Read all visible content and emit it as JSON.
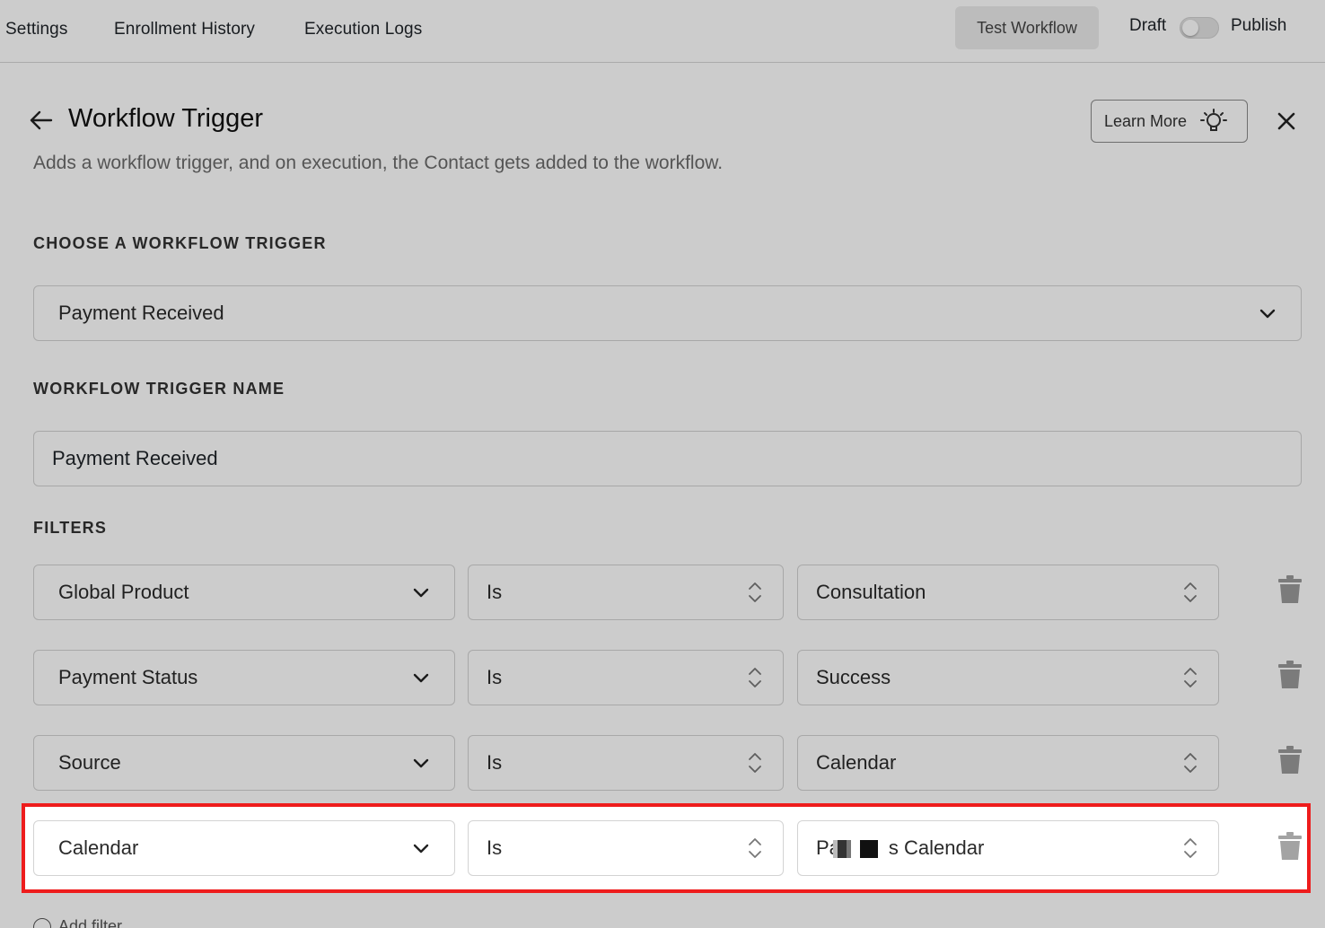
{
  "topbar": {
    "nav": [
      "Settings",
      "Enrollment History",
      "Execution Logs"
    ],
    "test_button": "Test Workflow",
    "draft_label": "Draft",
    "publish_label": "Publish"
  },
  "header": {
    "title": "Workflow Trigger",
    "subtitle": "Adds a workflow trigger, and on execution, the Contact gets added to the workflow.",
    "learn_more": "Learn More"
  },
  "trigger": {
    "label": "CHOOSE A WORKFLOW TRIGGER",
    "value": "Payment Received"
  },
  "trigger_name": {
    "label": "WORKFLOW TRIGGER NAME",
    "value": "Payment Received"
  },
  "filters": {
    "label": "FILTERS",
    "rows": [
      {
        "field": "Global Product",
        "operator": "Is",
        "value": "Consultation"
      },
      {
        "field": "Payment Status",
        "operator": "Is",
        "value": "Success"
      },
      {
        "field": "Source",
        "operator": "Is",
        "value": "Calendar"
      },
      {
        "field": "Calendar",
        "operator": "Is",
        "value_prefix": "Pa",
        "value_suffix": "s Calendar"
      }
    ],
    "add_filter": "Add filter"
  },
  "colors": {
    "highlight": "#ee1c1c",
    "overlay": "rgba(0,0,0,0.2)"
  }
}
